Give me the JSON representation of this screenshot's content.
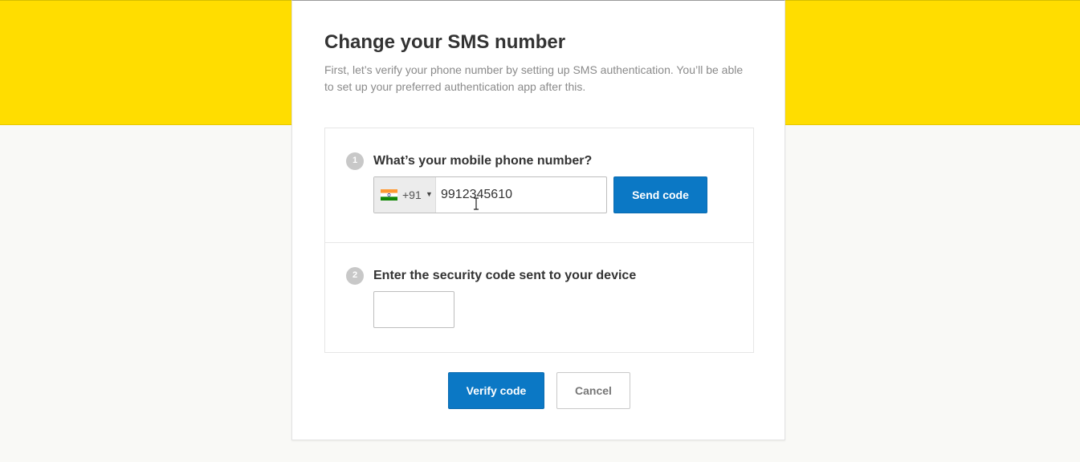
{
  "colors": {
    "brand_yellow": "#ffdd00",
    "primary_blue": "#0b78c5",
    "background": "#f9f9f6"
  },
  "page": {
    "title": "Change your SMS number",
    "subtitle": "First, let’s verify your phone number by setting up SMS authentication. You’ll be able to set up your preferred authentication app after this."
  },
  "step1": {
    "number": "1",
    "label": "What’s your mobile phone number?",
    "country_flag": "india-flag-icon",
    "dial_code": "+91",
    "phone_value": "9912345610",
    "send_label": "Send code"
  },
  "step2": {
    "number": "2",
    "label": "Enter the security code sent to your device",
    "code_value": ""
  },
  "actions": {
    "verify_label": "Verify code",
    "cancel_label": "Cancel"
  }
}
